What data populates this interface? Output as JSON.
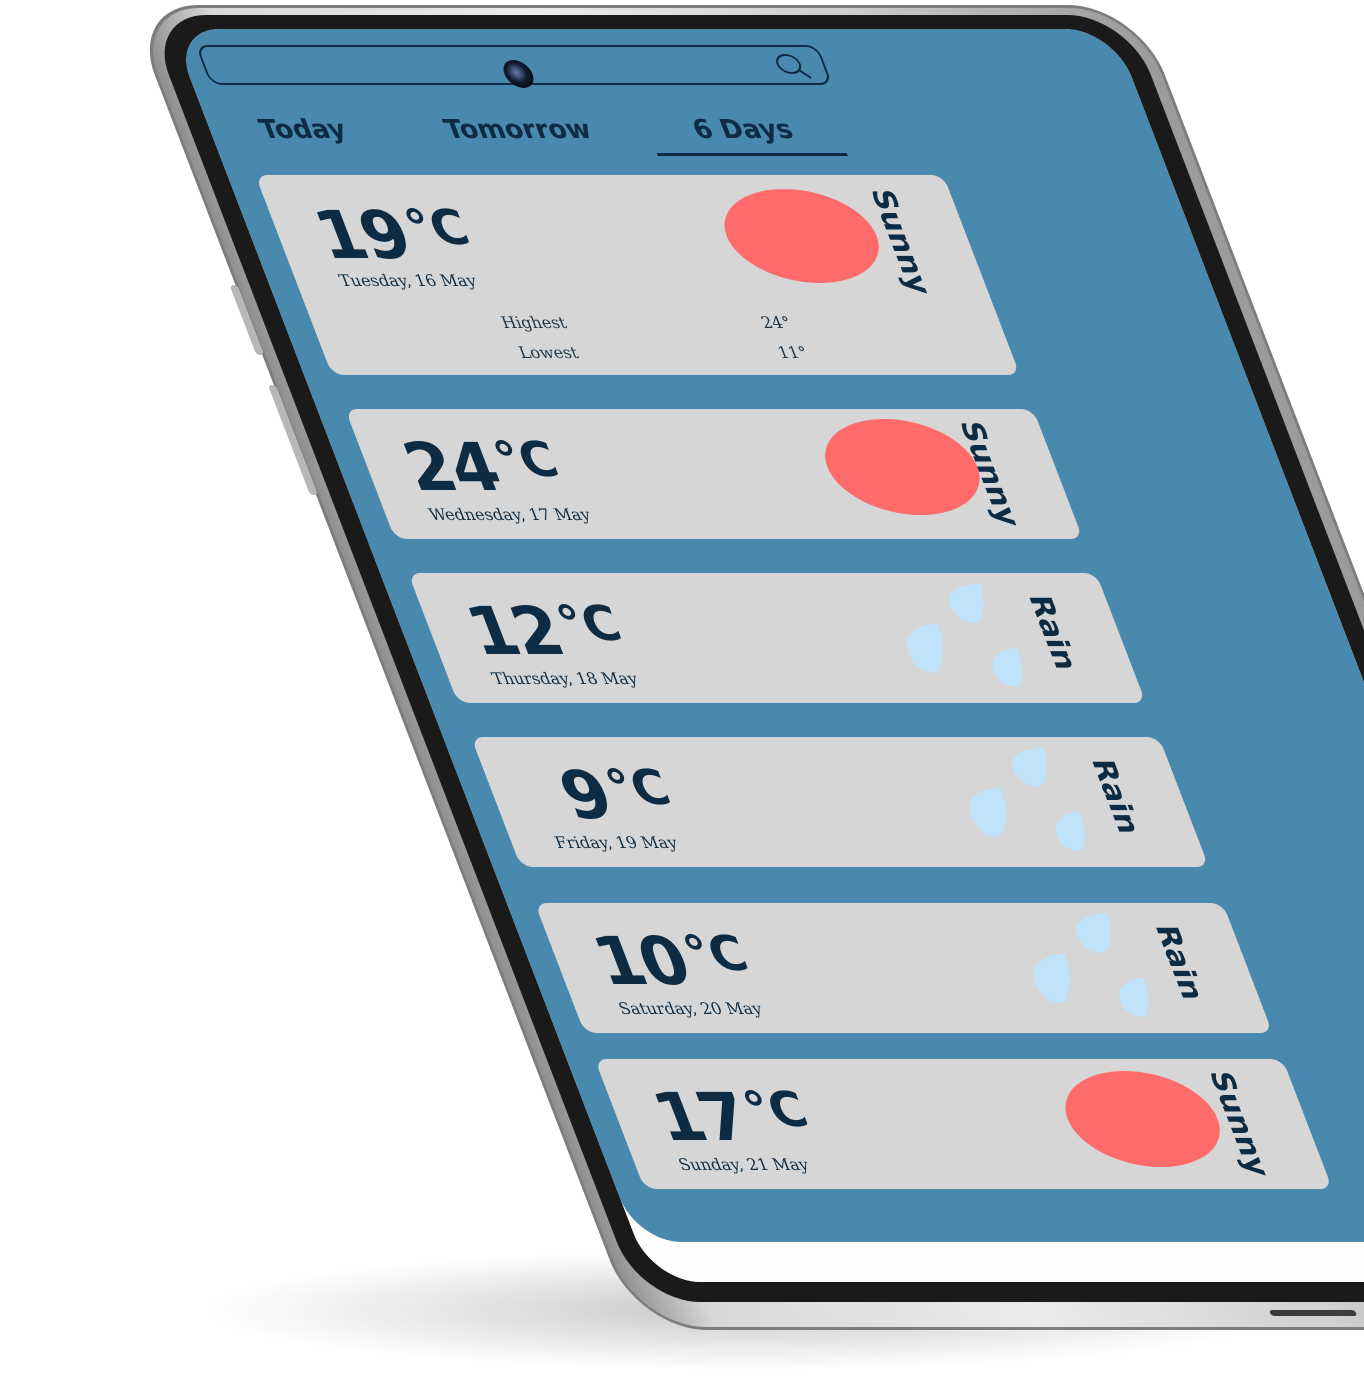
{
  "colors": {
    "screen_background": "#4a89ae",
    "card_background": "#d6d6d6",
    "text_dark": "#0d2c44",
    "sun": "#ff6b6b",
    "rain": "#bfe3fb"
  },
  "header": {
    "camera_icon": "camera-icon",
    "search_icon": "search-icon"
  },
  "tabs": [
    {
      "label": "Today",
      "active": false
    },
    {
      "label": "Tomorrow",
      "active": false
    },
    {
      "label": "6 Days",
      "active": true
    }
  ],
  "forecast": [
    {
      "temp": "19",
      "unit": "°C",
      "date": "Tuesday, 16 May",
      "condition": "Sunny",
      "icon": "sun-icon",
      "stats": [
        {
          "label": "Highest",
          "value": "24°"
        },
        {
          "label": "Lowest",
          "value": "11°"
        }
      ]
    },
    {
      "temp": "24",
      "unit": "°C",
      "date": "Wednesday, 17 May",
      "condition": "Sunny",
      "icon": "sun-icon"
    },
    {
      "temp": "12",
      "unit": "°C",
      "date": "Thursday, 18 May",
      "condition": "Rain",
      "icon": "rain-icon"
    },
    {
      "temp": "9",
      "unit": "°C",
      "date": "Friday, 19 May",
      "condition": "Rain",
      "icon": "rain-icon"
    },
    {
      "temp": "10",
      "unit": "°C",
      "date": "Saturday, 20 May",
      "condition": "Rain",
      "icon": "rain-icon"
    },
    {
      "temp": "17",
      "unit": "°C",
      "date": "Sunday, 21 May",
      "condition": "Sunny",
      "icon": "sun-icon"
    }
  ]
}
